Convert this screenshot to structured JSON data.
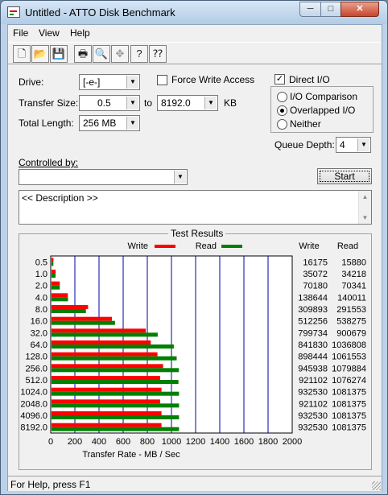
{
  "window": {
    "title": "Untitled - ATTO Disk Benchmark"
  },
  "caption_buttons": {
    "minimize": "─",
    "maximize": "□",
    "close": "✕"
  },
  "menu": [
    {
      "label": "File"
    },
    {
      "label": "View"
    },
    {
      "label": "Help"
    }
  ],
  "toolbar": [
    {
      "name": "new-icon",
      "glyph": "🗋"
    },
    {
      "name": "open-icon",
      "glyph": "📂"
    },
    {
      "name": "save-icon",
      "glyph": "💾"
    },
    {
      "name": "print-icon",
      "glyph": "🖶"
    },
    {
      "name": "print-preview-icon",
      "glyph": "🔍"
    },
    {
      "name": "move-icon",
      "glyph": "✥"
    },
    {
      "name": "help-icon",
      "glyph": "?"
    },
    {
      "name": "context-help-icon",
      "glyph": "⁇"
    }
  ],
  "settings": {
    "drive_label": "Drive:",
    "drive_value": "[-e-]",
    "force_write_label": "Force Write Access",
    "force_write_checked": false,
    "transfer_size_label": "Transfer Size:",
    "transfer_from": "0.5",
    "to_label": "to",
    "transfer_to": "8192.0",
    "kb_label": "KB",
    "total_length_label": "Total Length:",
    "total_length_value": "256 MB",
    "direct_io_label": "Direct I/O",
    "direct_io_checked": true,
    "io_options": [
      {
        "label": "I/O Comparison",
        "selected": false
      },
      {
        "label": "Overlapped I/O",
        "selected": true
      },
      {
        "label": "Neither",
        "selected": false
      }
    ],
    "queue_depth_label": "Queue Depth:",
    "queue_depth_value": "4",
    "controlled_by_label": "Controlled by:",
    "controlled_by_value": "",
    "start_label": "Start",
    "description": "<< Description >>"
  },
  "results": {
    "title": "Test Results",
    "legend_write": "Write",
    "legend_read": "Read",
    "col_write": "Write",
    "col_read": "Read",
    "xlabel": "Transfer Rate - MB / Sec",
    "colors": {
      "write": "#ff0000",
      "read": "#008000",
      "grid": "#0000aa"
    }
  },
  "chart_data": {
    "type": "bar",
    "orientation": "horizontal",
    "categories": [
      "0.5",
      "1.0",
      "2.0",
      "4.0",
      "8.0",
      "16.0",
      "32.0",
      "64.0",
      "128.0",
      "256.0",
      "512.0",
      "1024.0",
      "2048.0",
      "4096.0",
      "8192.0"
    ],
    "series": [
      {
        "name": "Write",
        "values": [
          16175,
          35072,
          70180,
          138644,
          309893,
          512256,
          799734,
          841830,
          898444,
          945938,
          921102,
          932530,
          921102,
          932530,
          932530
        ]
      },
      {
        "name": "Read",
        "values": [
          15880,
          34218,
          70341,
          140011,
          291553,
          538275,
          900679,
          1036808,
          1061553,
          1079884,
          1076274,
          1081375,
          1081375,
          1081375,
          1081375
        ]
      }
    ],
    "x_ticks": [
      "0",
      "200",
      "400",
      "600",
      "800",
      "1000",
      "1200",
      "1400",
      "1600",
      "1800",
      "2000"
    ],
    "xlim": [
      0,
      2000
    ],
    "xlabel": "Transfer Rate - MB / Sec",
    "value_unit_note": "bar length in MB/s",
    "grid": true
  },
  "status": {
    "text": "For Help, press F1"
  }
}
